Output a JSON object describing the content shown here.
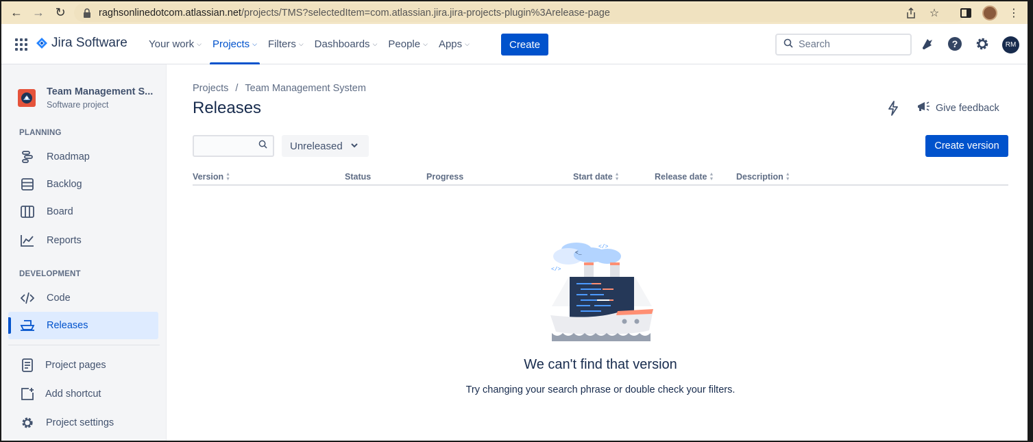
{
  "browser": {
    "url_host": "raghsonlinedotcom.atlassian.net",
    "url_path": "/projects/TMS?selectedItem=com.atlassian.jira.jira-projects-plugin%3Arelease-page"
  },
  "topnav": {
    "product": "Jira Software",
    "items": [
      {
        "label": "Your work",
        "active": false
      },
      {
        "label": "Projects",
        "active": true
      },
      {
        "label": "Filters",
        "active": false
      },
      {
        "label": "Dashboards",
        "active": false
      },
      {
        "label": "People",
        "active": false
      },
      {
        "label": "Apps",
        "active": false
      }
    ],
    "create_label": "Create",
    "search_placeholder": "Search",
    "avatar_initials": "RM"
  },
  "sidebar": {
    "project_name": "Team Management S...",
    "project_type": "Software project",
    "planning_heading": "PLANNING",
    "planning_items": [
      "Roadmap",
      "Backlog",
      "Board",
      "Reports"
    ],
    "development_heading": "DEVELOPMENT",
    "development_items": [
      "Code",
      "Releases"
    ],
    "active_item": "Releases",
    "footer_items": [
      "Project pages",
      "Add shortcut",
      "Project settings"
    ]
  },
  "main": {
    "breadcrumb": [
      "Projects",
      "Team Management System"
    ],
    "breadcrumb_sep": "/",
    "title": "Releases",
    "feedback_label": "Give feedback",
    "filter_value": "Unreleased",
    "create_version_label": "Create version",
    "columns": [
      "Version",
      "Status",
      "Progress",
      "Start date",
      "Release date",
      "Description"
    ],
    "empty_title": "We can't find that version",
    "empty_desc": "Try changing your search phrase or double check your filters."
  },
  "colors": {
    "primary": "#0052CC",
    "text": "#172B4D",
    "sidebar_bg": "#F4F5F7",
    "active_bg": "#DEEBFF",
    "browser_bar": "#f3e6c6"
  }
}
